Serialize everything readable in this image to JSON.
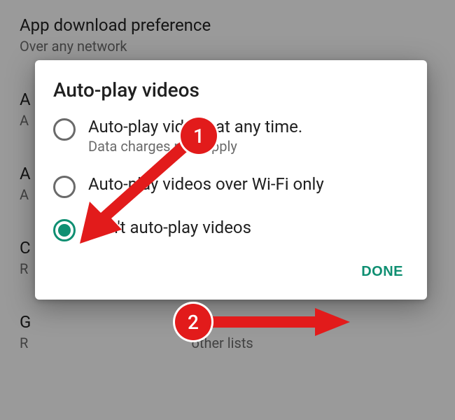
{
  "background_prefs": [
    {
      "title": "App download preference",
      "sub": "Over any network"
    },
    {
      "title": "A",
      "sub": "A"
    },
    {
      "title": "A",
      "sub": "A"
    },
    {
      "title": "C",
      "sub": "R"
    },
    {
      "title": "G",
      "sub": "R                                               other lists"
    }
  ],
  "dialog": {
    "title": "Auto-play videos",
    "options": [
      {
        "label": "Auto-play videos at any time.",
        "sublabel": "Data charges may apply",
        "selected": false
      },
      {
        "label": "Auto-play videos over Wi-Fi only",
        "sublabel": "",
        "selected": false
      },
      {
        "label": "Don't auto-play videos",
        "sublabel": "",
        "selected": true
      }
    ],
    "done_label": "DONE"
  },
  "annotations": {
    "step1": "1",
    "step2": "2"
  }
}
